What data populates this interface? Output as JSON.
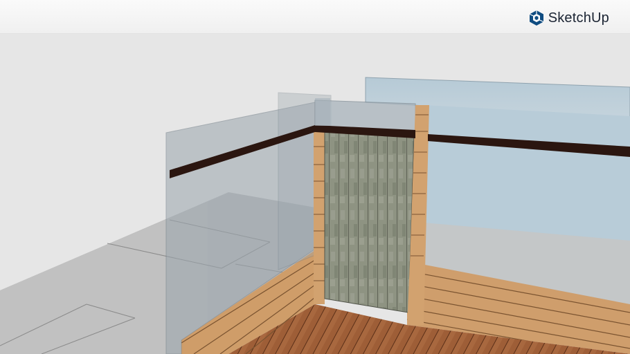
{
  "header": {
    "brand_name": "SketchUp",
    "brand_icon": "sketchup-logo-icon",
    "brand_color": "#0f4c81"
  },
  "viewport": {
    "scene": "3d-model-deck-with-glass-railings",
    "colors": {
      "background": "#e6e6e6",
      "ground": "#bfbfbf",
      "glass": "#a9b4bd",
      "glass_blue": "#b9cdd9",
      "handrail": "#2b1610",
      "siding": "#cf9d6a",
      "deck": "#9a5b35",
      "stone": "#8d9180"
    }
  }
}
